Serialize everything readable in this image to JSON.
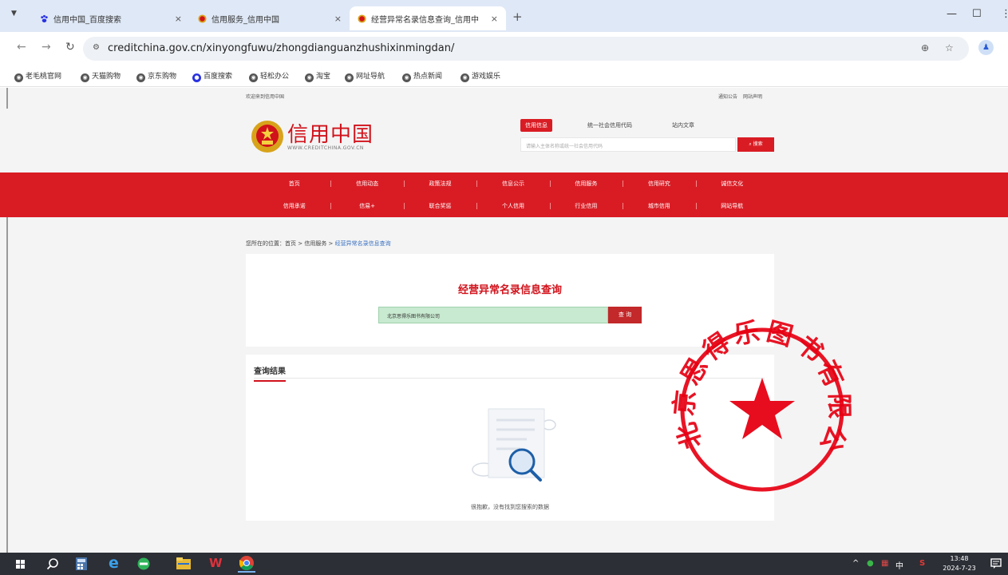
{
  "browser": {
    "tabs": [
      {
        "label": "信用中国_百度搜索",
        "icon": "baidu-paw-icon",
        "active": false
      },
      {
        "label": "信用服务_信用中国",
        "icon": "emblem-icon",
        "active": false
      },
      {
        "label": "经营异常名录信息查询_信用中",
        "icon": "emblem-icon",
        "active": true
      }
    ],
    "tab_close": "×",
    "new_tab": "+",
    "url": "creditchina.gov.cn/xinyongfuwu/zhongdianguanzhushixinmingdan/",
    "profile_initial": "♟",
    "bookmarks": [
      "老毛桃官网",
      "天猫购物",
      "京东购物",
      "百度搜索",
      "轻松办公",
      "淘宝",
      "网址导航",
      "热点新闻",
      "游戏娱乐"
    ]
  },
  "site": {
    "welcome": "欢迎来到信用中国",
    "top_links": [
      "通知公告",
      "网站声明"
    ],
    "logo_title": "信用中国",
    "logo_sub": "WWW.CREDITCHINA.GOV.CN",
    "search_tabs": [
      "信用信息",
      "统一社会信用代码",
      "站内文章"
    ],
    "search_placeholder": "请输入主体名称或统一社会信用代码",
    "search_button": "搜索",
    "nav_row1": [
      "首页",
      "信用动态",
      "政策法规",
      "信息公示",
      "信用服务",
      "信用研究",
      "诚信文化"
    ],
    "nav_row2": [
      "信用承诺",
      "信易+",
      "联合奖惩",
      "个人信用",
      "行业信用",
      "城市信用",
      "网站导航"
    ],
    "breadcrumb": {
      "prefix": "您所在的位置：",
      "home": "首页",
      "sep": " > ",
      "level2": "信用服务",
      "current": "经营异常名录信息查询"
    },
    "query": {
      "title": "经营异常名录信息查询",
      "input_value": "北京思得乐图书有限公司",
      "button": "查 询"
    },
    "results": {
      "title": "查询结果",
      "empty_text": "很抱歉，没有找到您搜索的数据"
    },
    "stamp_text": "北京思得乐图书有限公司"
  },
  "taskbar": {
    "time": "13:48",
    "date": "2024-7-23",
    "tray_lang": "中",
    "tray_chevron": "^"
  },
  "colors": {
    "brand_red": "#d91c24",
    "stamp_red": "#e60012",
    "tabbar_bg": "#dfe8f6",
    "query_input_bg": "#c8ead0"
  }
}
